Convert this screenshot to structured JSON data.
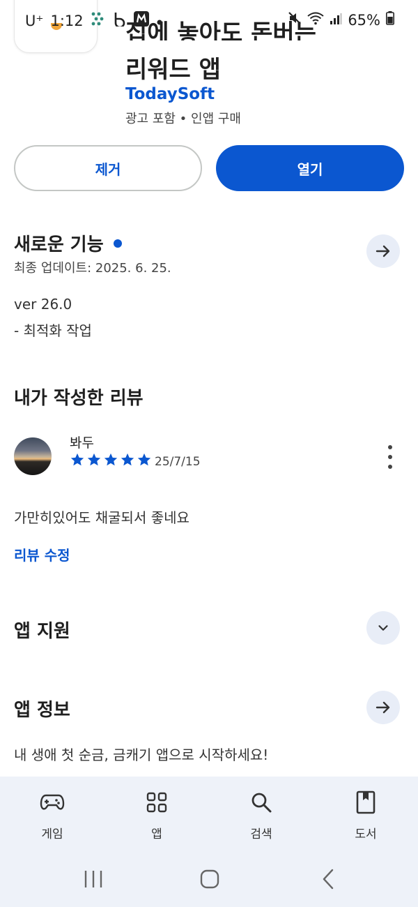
{
  "status_bar": {
    "carrier": "U⁺",
    "time": "1:12",
    "battery": "65%"
  },
  "app": {
    "title_line1": "집에 놓아도 돈버는",
    "title_line2": "리워드 앱",
    "developer": "TodaySoft",
    "meta": "광고 포함 • 인앱 구매"
  },
  "actions": {
    "remove_label": "제거",
    "open_label": "열기"
  },
  "whats_new": {
    "title": "새로운 기능",
    "last_updated": "최종 업데이트: 2025. 6. 25.",
    "version": "ver 26.0",
    "notes": "- 최적화 작업"
  },
  "my_review": {
    "title": "내가 작성한 리뷰",
    "reviewer": "봐두",
    "rating": 5,
    "date": "25/7/15",
    "text": "가만히있어도 채굴되서 좋네요",
    "edit_label": "리뷰 수정"
  },
  "app_support": {
    "title": "앱 지원"
  },
  "about": {
    "title": "앱 정보",
    "description": "내 생애 첫 순금, 금캐기 앱으로 시작하세요!"
  },
  "bottom_nav": {
    "items": [
      {
        "label": "게임",
        "icon": "gamepad-icon"
      },
      {
        "label": "앱",
        "icon": "apps-grid-icon"
      },
      {
        "label": "검색",
        "icon": "search-icon"
      },
      {
        "label": "도서",
        "icon": "book-icon"
      }
    ]
  },
  "colors": {
    "accent": "#0b57d0",
    "nav_background": "#eef2f9"
  }
}
